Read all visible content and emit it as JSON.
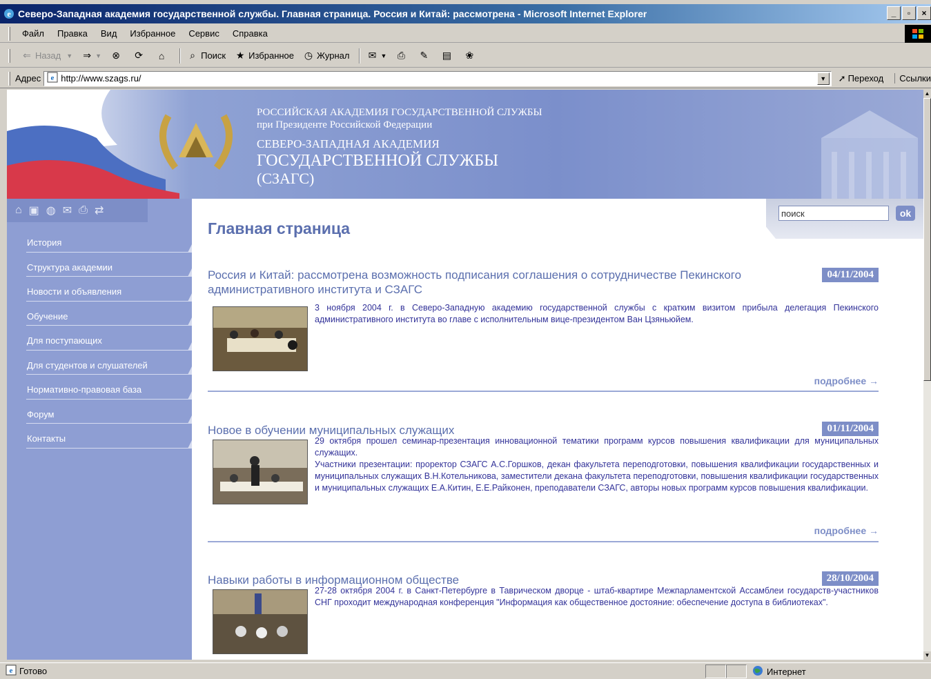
{
  "window": {
    "title": "Северо-Западная академия государственной службы. Главная страница. Россия и Китай: рассмотрена  - Microsoft Internet Explorer",
    "min": "_",
    "max": "▫",
    "close": "×"
  },
  "menu": [
    "Файл",
    "Правка",
    "Вид",
    "Избранное",
    "Сервис",
    "Справка"
  ],
  "toolbar": {
    "back": "Назад",
    "search": "Поиск",
    "favorites": "Избранное",
    "history": "Журнал"
  },
  "address": {
    "label": "Адрес",
    "url": "http://www.szags.ru/",
    "go": "Переход",
    "links": "Ссылки"
  },
  "status": {
    "text": "Готово",
    "zone": "Интернет"
  },
  "site": {
    "header": {
      "line1": "РОССИЙСКАЯ АКАДЕМИЯ ГОСУДАРСТВЕННОЙ СЛУЖБЫ",
      "line2": "при Президенте Российской Федерации",
      "line3": "СЕВЕРО-ЗАПАДНАЯ АКАДЕМИЯ",
      "line4": "ГОСУДАРСТВЕННОЙ СЛУЖБЫ",
      "line5": "(СЗАГС)"
    },
    "search": {
      "placeholder": "поиск",
      "button": "ok"
    },
    "nav": [
      "История",
      "Структура академии",
      "Новости и объявления",
      "Обучение",
      "Для поступающих",
      "Для студентов и слушателей",
      "Нормативно-правовая база",
      "Форум",
      "Контакты"
    ],
    "page_title": "Главная страница",
    "more_label": "подробнее →",
    "news": [
      {
        "title": "Россия и Китай: рассмотрена возможность подписания соглашения о сотрудничестве Пекинского административного института и СЗАГС",
        "date": "04/11/2004",
        "text": "3 ноября 2004 г. в Северо-Западную академию государственной службы с кратким визитом прибыла делегация Пекинского административного института во главе с исполнительным вице-президентом Ван Цзяньюйем."
      },
      {
        "title": "Новое в обучении муниципальных служащих",
        "date": "01/11/2004",
        "text": "29 октября прошел семинар-презентация инновационной тематики программ курсов повышения квалификации для муниципальных служащих.",
        "text2": "Участники презентации: проректор СЗАГС А.С.Горшков, декан факультета переподготовки, повышения квалификации государственных и муниципальных служащих В.Н.Котельникова, заместители декана факультета переподготовки, повышения квалификации государственных и муниципальных служащих Е.А.Китин, Е.Е.Райконен, преподаватели СЗАГС, авторы новых программ курсов повышения квалификации."
      },
      {
        "title": "Навыки работы в информационном обществе",
        "date": "28/10/2004",
        "text": "27-28 октября 2004 г. в Санкт-Петербурге в Таврическом дворце - штаб-квартире Межпарламентской Ассамблеи государств-участников СНГ проходит международная конференция \"Информация как общественное достояние: обеспечение доступа в библиотеках\"."
      }
    ]
  }
}
